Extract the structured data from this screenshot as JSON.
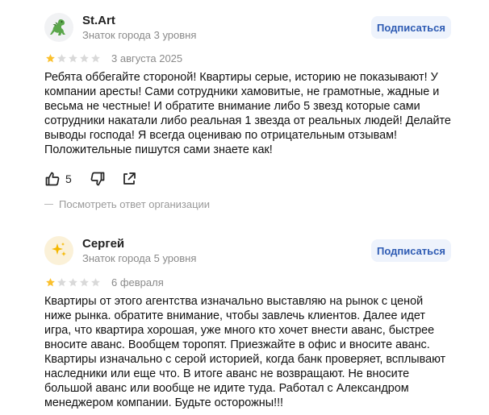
{
  "reviews": [
    {
      "author": "St.Art",
      "level": "Знаток города 3 уровня",
      "avatar_icon": "dinosaur-icon",
      "subscribe_label": "Подписаться",
      "rating": 1,
      "rating_max": 5,
      "date": "3 августа 2025",
      "text": "Ребята оббегайте стороной! Квартиры серые, историю не показывают! У компании аресты! Сами сотрудники хамовитые, не грамотные, жадные и весьма не честные! И обратите внимание либо 5 звезд которые сами сотрудники накатали либо реальная 1 звезда от реальных людей! Делайте выводы господа! Я всегда оцениваю по отрицательным отзывам! Положительные пишутся сами знаете как!",
      "likes": "5",
      "org_reply_label": "Посмотреть ответ организации"
    },
    {
      "author": "Сергей",
      "level": "Знаток города 5 уровня",
      "avatar_icon": "sparkles-icon",
      "subscribe_label": "Подписаться",
      "rating": 1,
      "rating_max": 5,
      "date": "6 февраля",
      "text": "Квартиры от этого агентства изначально выставляю на рынок с ценой ниже рынка. обратите внимание, чтобы завлечь клиентов. Далее идет игра, что квартира хорошая, уже много кто хочет внести аванс, быстрее вносите аванс. Вообщем торопят. Приезжайте в офис и вносите аванс. Квартиры изначально с серой историей, когда банк проверяет, всплывают наследники или еще что. В итоге аванс не возвращают. Не вносите большой аванс или вообще не идите туда. Работал с Александром менеджером компании. Будьте осторожны!!!"
    }
  ],
  "colors": {
    "star_filled": "#fbc02d",
    "star_empty": "#d9d9d9",
    "subscribe_bg": "#eef3fc",
    "subscribe_text": "#2e5bb3"
  }
}
